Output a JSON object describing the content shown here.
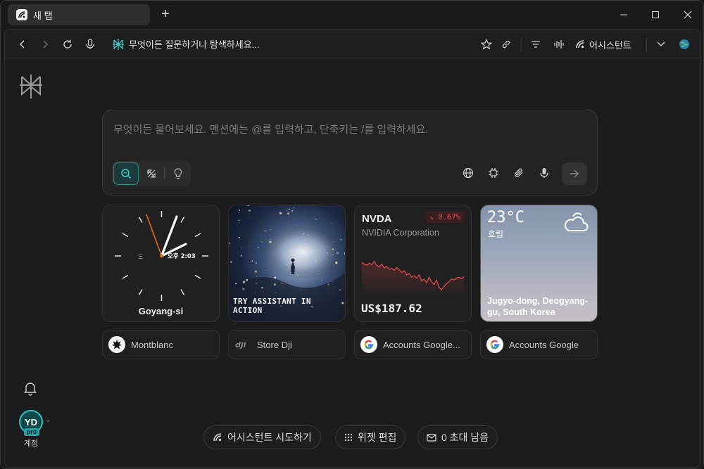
{
  "tab": {
    "title": "새 탭",
    "new_tab_symbol": "+"
  },
  "address": {
    "text": "무엇이든 질문하거나 탐색하세요..."
  },
  "toolbar": {
    "assistant_label": "어시스턴트"
  },
  "search": {
    "placeholder": "무엇이든 물어보세요. 멘션에는 @를 입력하고, 단축키는 /를 입력하세요."
  },
  "widgets": {
    "clock": {
      "city": "Goyang-si",
      "face_label": "오후 2:03"
    },
    "art": {
      "caption": "TRY ASSISTANT IN ACTION"
    },
    "stock": {
      "ticker": "NVDA",
      "name": "NVIDIA Corporation",
      "change": "↘ 0.67%",
      "price": "US$187.62",
      "series": [
        0.62,
        0.58,
        0.56,
        0.6,
        0.57,
        0.64,
        0.55,
        0.52,
        0.58,
        0.5,
        0.53,
        0.47,
        0.49,
        0.45,
        0.51,
        0.46,
        0.4,
        0.44,
        0.35,
        0.38,
        0.3,
        0.33,
        0.28,
        0.35,
        0.22,
        0.26,
        0.18,
        0.3,
        0.2,
        0.14,
        0.24,
        0.08,
        0.03,
        0.1,
        0.16,
        0.2,
        0.26,
        0.24,
        0.28,
        0.3,
        0.27,
        0.31
      ]
    },
    "weather": {
      "temp": "23°C",
      "condition": "흐림",
      "location": "Jugyo-dong, Deogyang-gu, South Korea"
    }
  },
  "shortcuts": [
    {
      "label": "Montblanc",
      "icon": "montblanc-icon"
    },
    {
      "label": "Store Dji",
      "icon": "dji-icon"
    },
    {
      "label": "Accounts Google...",
      "icon": "google-icon"
    },
    {
      "label": "Accounts Google",
      "icon": "google-icon"
    }
  ],
  "bottom": {
    "try_assistant": "어시스턴트 시도하기",
    "edit_widgets": "위젯 편집",
    "timer": "0 초대 남음"
  },
  "account": {
    "initials": "YD",
    "badge": "pro",
    "label": "계정"
  },
  "colors": {
    "accent": "#34c0c0",
    "stock_line": "#d94848",
    "background": "#1c1c1c"
  }
}
